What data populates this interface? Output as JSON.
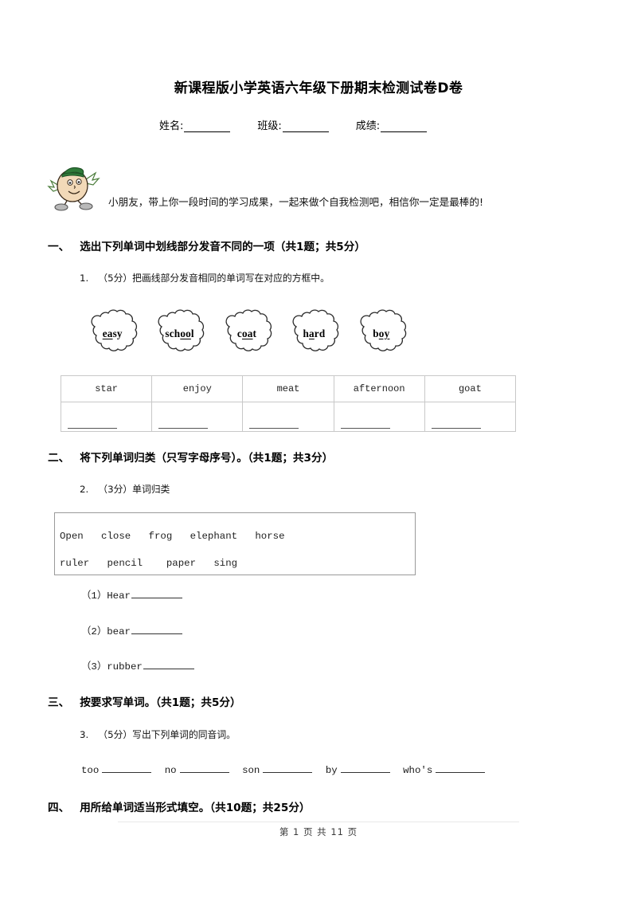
{
  "document": {
    "title": "新课程版小学英语六年级下册期末检测试卷D卷",
    "identity_fields": [
      {
        "label": "姓名:",
        "value": ""
      },
      {
        "label": "班级:",
        "value": ""
      },
      {
        "label": "成绩:",
        "value": ""
      }
    ],
    "greeting": "小朋友，带上你一段时间的学习成果，一起来做个自我检测吧，相信你一定是最棒的!",
    "mascot_icon": "cartoon-boy-mascot-icon",
    "footer": "第 1 页 共 11 页"
  },
  "sections": [
    {
      "number": "一、",
      "heading": "选出下列单词中划线部分发音不同的一项（共1题；共5分）",
      "question": {
        "no": "1.",
        "text": "（5分）把画线部分发音相同的单词写在对应的方框中。"
      },
      "bubbles": [
        {
          "pre": "",
          "mid": "ea",
          "post": "sy",
          "full": "easy"
        },
        {
          "pre": "sch",
          "mid": "oo",
          "post": "l",
          "full": "school"
        },
        {
          "pre": "c",
          "mid": "oa",
          "post": "t",
          "full": "coat"
        },
        {
          "pre": "h",
          "mid": "a",
          "post": "rd",
          "full": "hard"
        },
        {
          "pre": "b",
          "mid": "oy",
          "post": "",
          "full": "boy"
        }
      ],
      "table": {
        "headers": [
          "star",
          "enjoy",
          "meat",
          "afternoon",
          "goat"
        ],
        "answer_row": [
          "",
          "",
          "",
          "",
          ""
        ]
      }
    },
    {
      "number": "二、",
      "heading": "将下列单词归类（只写字母序号）。（共1题；共3分）",
      "question": {
        "no": "2.",
        "text": "（3分）单词归类"
      },
      "word_box": [
        "Open   close   frog   elephant   horse",
        "ruler   pencil    paper   sing"
      ],
      "sub_items": [
        {
          "label": "（1）Hear",
          "answer": ""
        },
        {
          "label": "（2）bear",
          "answer": ""
        },
        {
          "label": "（3）rubber",
          "answer": ""
        }
      ]
    },
    {
      "number": "三、",
      "heading": "按要求写单词。（共1题；共5分）",
      "question": {
        "no": "3.",
        "text": "（5分）写出下列单词的同音词。"
      },
      "homophones": [
        "too",
        "no",
        "son",
        "by",
        "who's"
      ]
    },
    {
      "number": "四、",
      "heading": "用所给单词适当形式填空。（共10题；共25分）"
    }
  ]
}
